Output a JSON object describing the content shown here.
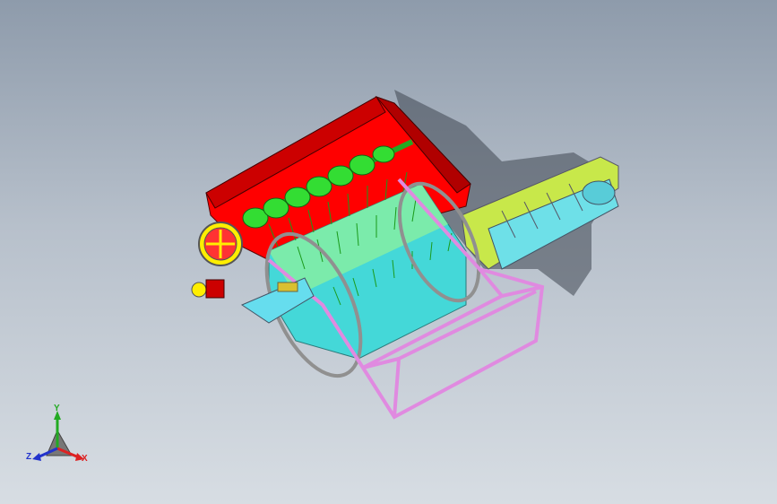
{
  "viewport": {
    "background_top": "#8e9bab",
    "background_bottom": "#d7dde3"
  },
  "model": {
    "colors": {
      "hopper": "#ff0000",
      "auger": "#33dd33",
      "drum": "#44d8d8",
      "teeth": "#22bb22",
      "frame": "#e08ae0",
      "ring": "#909090",
      "conveyor": "#c8e84a",
      "conveyor_slats": "#6ee0e8",
      "pulley": "#ffee00",
      "plate": "#66ddee"
    },
    "parts": [
      "hopper-housing",
      "auger-screw",
      "threshing-drum",
      "drum-teeth",
      "end-ring",
      "base-frame",
      "belt-pulley",
      "motor-mount-plate",
      "discharge-conveyor"
    ]
  },
  "triad": {
    "y_label": "Y",
    "x_label": "X",
    "z_label": "Z",
    "y_color": "#22aa22",
    "x_color": "#dd2222",
    "z_color": "#2233cc"
  }
}
